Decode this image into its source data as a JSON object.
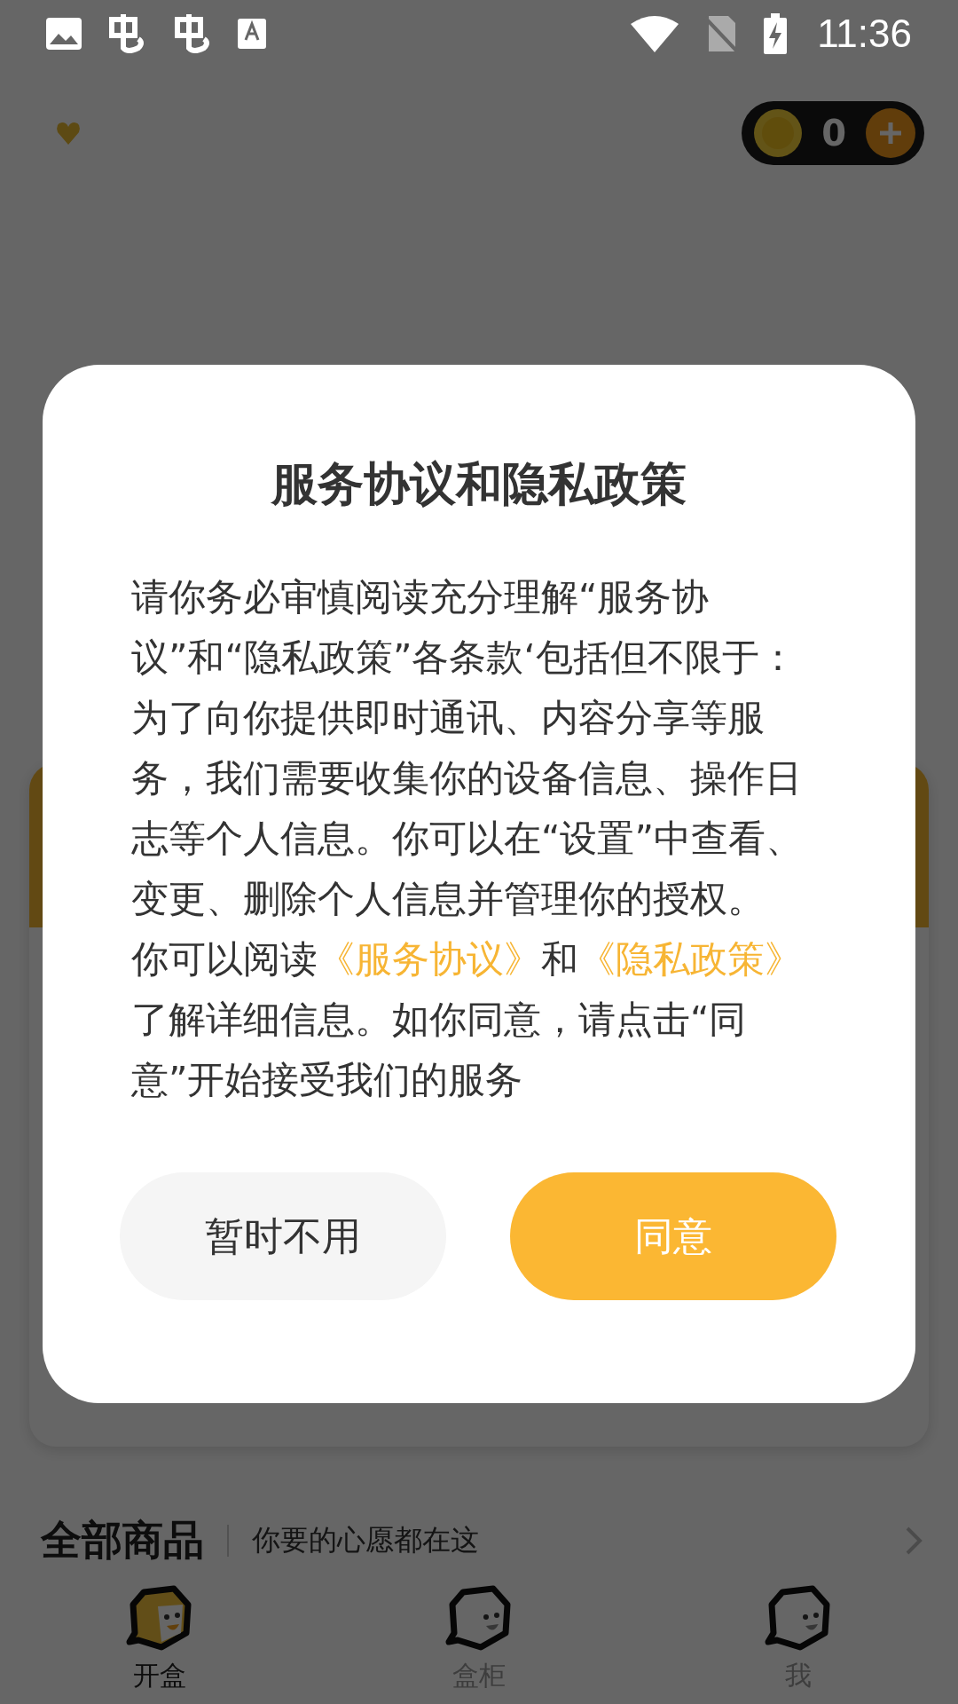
{
  "status_bar": {
    "time": "11:36"
  },
  "header": {
    "coins": "0"
  },
  "dialog": {
    "title": "服务协议和隐私政策",
    "body": "请你务必审慎阅读充分理解“服务协议”和“隐私政策”各条款‘包括但不限于：为了向你提供即时通讯、内容分享等服务，我们需要收集你的设备信息、操作日志等个人信息。你可以在“设置”中查看、变更、删除个人信息并管理你的授权。",
    "links_paragraph": [
      {
        "kind": "text",
        "text": "你可以阅读"
      },
      {
        "kind": "link",
        "text": "《服务协议》"
      },
      {
        "kind": "text",
        "text": "和"
      },
      {
        "kind": "link",
        "text": "《隐私政策》"
      },
      {
        "kind": "text",
        "text": "了解详细信息。如你同意，请点击“同意”开始接受我们的服务"
      }
    ],
    "buttons": [
      {
        "label": "暂时不用",
        "kind": "secondary"
      },
      {
        "label": "同意",
        "kind": "primary"
      }
    ]
  },
  "section": {
    "title": "全部商品",
    "subtitle": "你要的心愿都在这"
  },
  "nav": [
    {
      "label": "开盒",
      "selected": true
    },
    {
      "label": "盒柜",
      "selected": false
    },
    {
      "label": "我",
      "selected": false
    }
  ]
}
